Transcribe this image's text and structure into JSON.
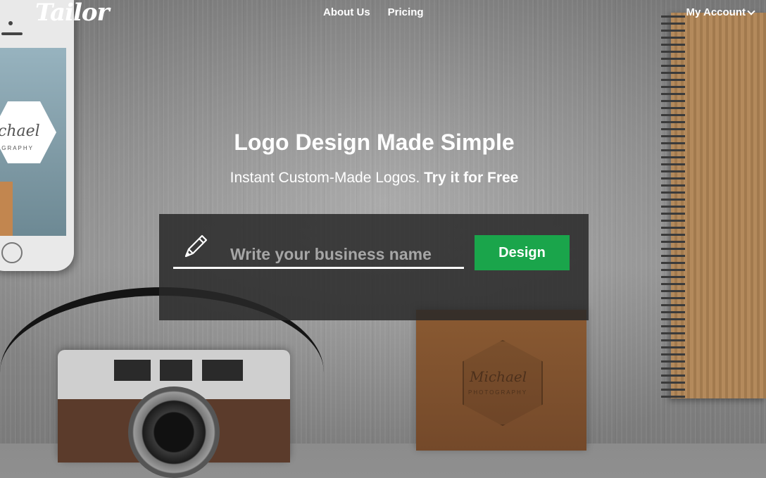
{
  "header": {
    "logo_text": "Tailor",
    "nav": [
      {
        "label": "About Us"
      },
      {
        "label": "Pricing"
      }
    ],
    "account_label": "My Account",
    "account_icon": "chevron-down-icon"
  },
  "hero": {
    "title": "Logo Design Made Simple",
    "subtitle": "Instant Custom-Made Logos.",
    "subtitle_bold": "Try it for Free"
  },
  "form": {
    "input_placeholder": "Write your business name",
    "input_value": "",
    "input_icon": "pencil-icon",
    "button_label": "Design",
    "button_color": "#1aa54b"
  },
  "props": {
    "phone_brand_text": "ichael",
    "phone_sub_text": "OGRAPHY",
    "box_brand_text": "Michael",
    "box_sub_text": "PHOTOGRAPHY"
  }
}
